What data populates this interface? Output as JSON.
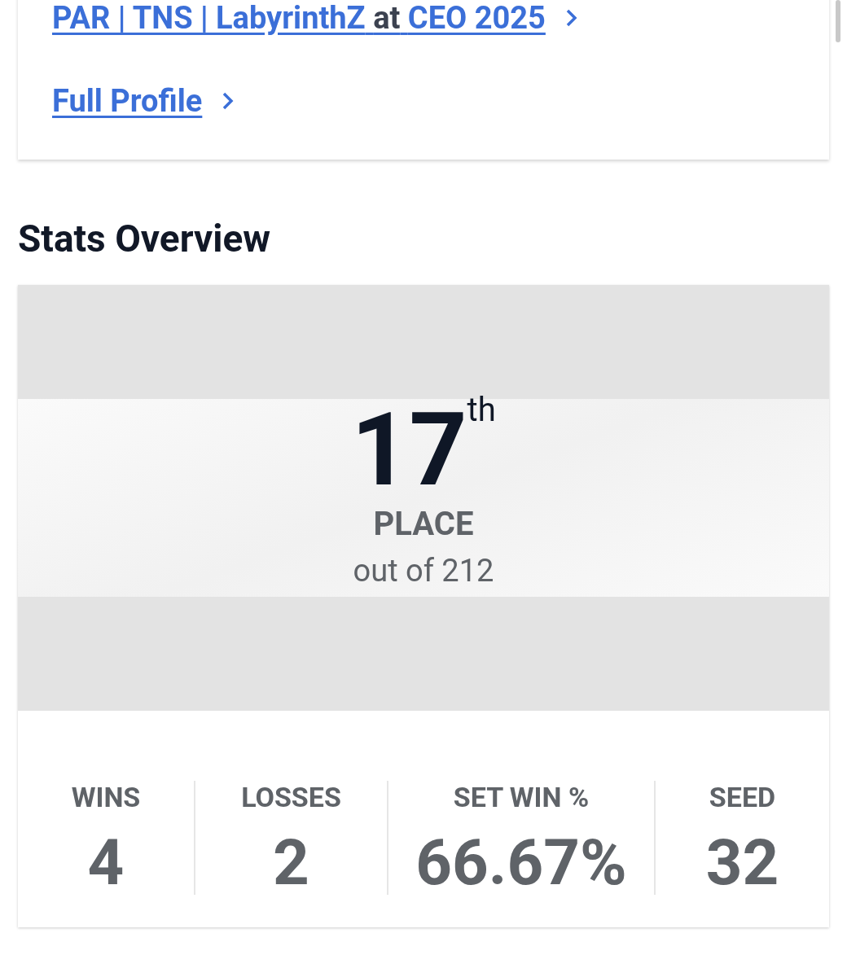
{
  "profile_card": {
    "event_link": {
      "player": "PAR | TNS | LabyrinthZ",
      "connector": "at",
      "event": "CEO 2025"
    },
    "profile_link": "Full Profile"
  },
  "section_title": "Stats Overview",
  "placement": {
    "rank": "17",
    "suffix": "th",
    "label": "PLACE",
    "total": "out of 212"
  },
  "stats": [
    {
      "label": "WINS",
      "value": "4"
    },
    {
      "label": "LOSSES",
      "value": "2"
    },
    {
      "label": "SET WIN %",
      "value": "66.67%"
    },
    {
      "label": "SEED",
      "value": "32"
    }
  ]
}
